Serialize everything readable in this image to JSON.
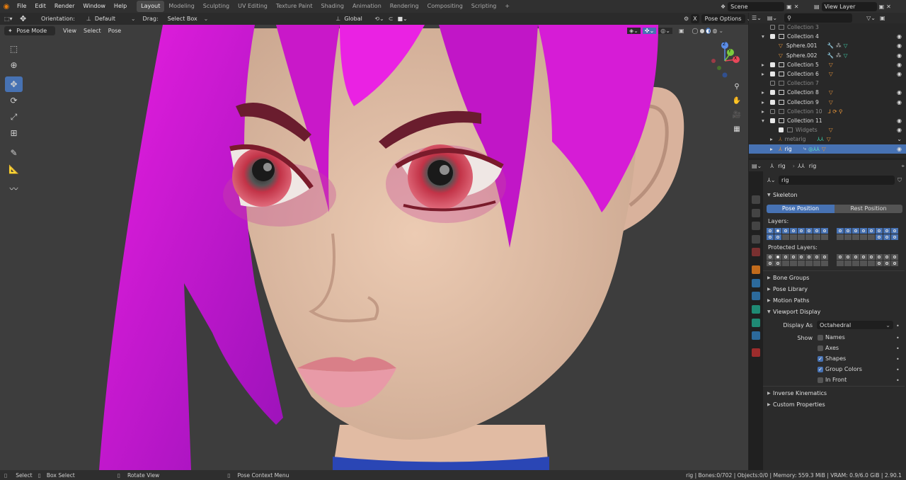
{
  "topbar": {
    "menus": [
      "File",
      "Edit",
      "Render",
      "Window",
      "Help"
    ],
    "workspaces": [
      "Layout",
      "Modeling",
      "Sculpting",
      "UV Editing",
      "Texture Paint",
      "Shading",
      "Animation",
      "Rendering",
      "Compositing",
      "Scripting"
    ],
    "active_workspace": "Layout",
    "add_tab": "+",
    "scene": "Scene",
    "view_layer": "View Layer"
  },
  "header": {
    "orientation_label": "Orientation:",
    "orientation_value": "Default",
    "drag_label": "Drag:",
    "drag_value": "Select Box",
    "transform_orientation": "Global",
    "pose_options": "Pose Options",
    "close_x": "X"
  },
  "viewport_menu": {
    "mode": "Pose Mode",
    "items": [
      "View",
      "Select",
      "Pose"
    ]
  },
  "gizmo": {
    "x": "X",
    "y": "Y",
    "z": "Z"
  },
  "outliner": {
    "search_placeholder": "",
    "rows": [
      {
        "label": "Collection 3",
        "dim": true
      },
      {
        "label": "Collection 4",
        "dim": false
      },
      {
        "label": "Sphere.001",
        "dim": false
      },
      {
        "label": "Sphere.002",
        "dim": false
      },
      {
        "label": "Collection 5",
        "dim": false
      },
      {
        "label": "Collection 6",
        "dim": false
      },
      {
        "label": "Collection 7",
        "dim": true
      },
      {
        "label": "Collection 8",
        "dim": false
      },
      {
        "label": "Collection 9",
        "dim": false
      },
      {
        "label": "Collection 10",
        "dim": true
      },
      {
        "label": "Collection 11",
        "dim": false
      },
      {
        "label": "Widgets",
        "dim": true
      },
      {
        "label": "metarig",
        "dim": true
      },
      {
        "label": "rig",
        "dim": false,
        "selected": true
      }
    ]
  },
  "properties": {
    "object_name": "rig",
    "armature_name": "rig",
    "data_field": "rig",
    "skeleton": "Skeleton",
    "pose_position": "Pose Position",
    "rest_position": "Rest Position",
    "layers": "Layers:",
    "protected_layers": "Protected Layers:",
    "bone_groups": "Bone Groups",
    "pose_library": "Pose Library",
    "motion_paths": "Motion Paths",
    "viewport_display": "Viewport Display",
    "display_as_label": "Display As",
    "display_as_value": "Octahedral",
    "show_label": "Show",
    "show_options": [
      {
        "label": "Names",
        "checked": false
      },
      {
        "label": "Axes",
        "checked": false
      },
      {
        "label": "Shapes",
        "checked": true
      },
      {
        "label": "Group Colors",
        "checked": true
      },
      {
        "label": "In Front",
        "checked": false
      }
    ],
    "inverse_kinematics": "Inverse Kinematics",
    "custom_properties": "Custom Properties"
  },
  "status": {
    "select": "Select",
    "box_select": "Box Select",
    "rotate_view": "Rotate View",
    "context_menu": "Pose Context Menu",
    "stats": "rig | Bones:0/702 | Objects:0/0 | Memory: 559.3 MiB | VRAM: 0.9/6.0 GiB | 2.90.1"
  },
  "colors": {
    "accent": "#4772b3",
    "hair": "#d21ccf",
    "skin": "#e6c3ab",
    "background": "#3d3d3d"
  }
}
